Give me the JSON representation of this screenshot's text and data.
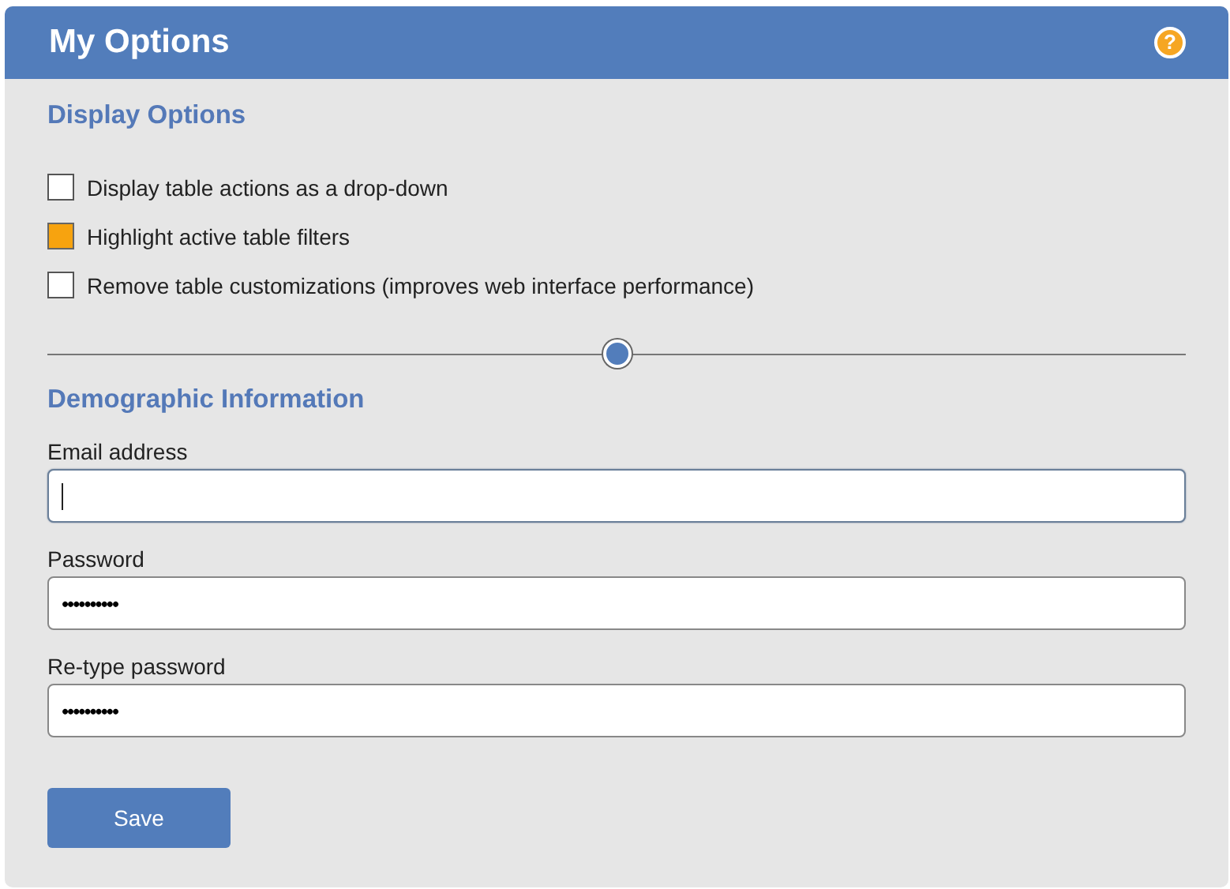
{
  "window": {
    "title": "My Options",
    "help_icon": "?"
  },
  "display_options": {
    "heading": "Display Options",
    "checkboxes": [
      {
        "label": "Display table actions as a drop-down",
        "checked": false
      },
      {
        "label": "Highlight active table filters",
        "checked": true
      },
      {
        "label": "Remove table customizations (improves web interface performance)",
        "checked": false
      }
    ],
    "slider": {
      "level": 0.5
    }
  },
  "demographic": {
    "heading": "Demographic Information",
    "fields": [
      {
        "label": "Email address",
        "focused": true
      },
      {
        "label": "Password",
        "value": "••••••••••",
        "focused": false
      },
      {
        "label": "Re-type password",
        "value": "••••••••••",
        "focused": false
      }
    ]
  },
  "buttons": [
    "Save"
  ]
}
